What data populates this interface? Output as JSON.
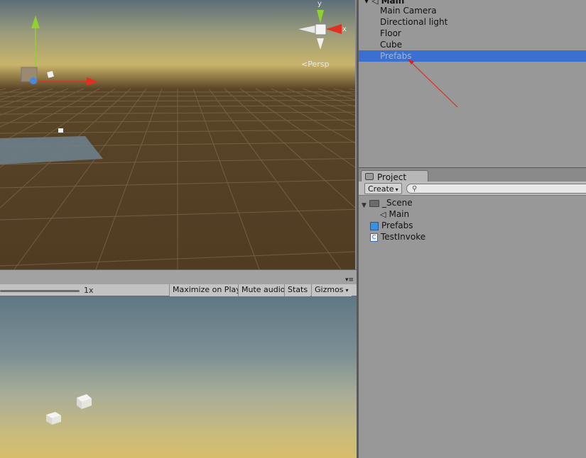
{
  "scene": {
    "persp_label": "Persp",
    "gizmo_labels": {
      "y": "y",
      "x": "x"
    }
  },
  "game_toolbar": {
    "scale_value": "1x",
    "maximize_on_play": "Maximize on Play",
    "mute_audio": "Mute audio",
    "stats": "Stats",
    "gizmos": "Gizmos"
  },
  "hierarchy": {
    "root": "Main",
    "items": [
      {
        "label": "Main Camera"
      },
      {
        "label": "Directional light"
      },
      {
        "label": "Floor"
      },
      {
        "label": "Cube"
      },
      {
        "label": "Prefabs",
        "selected": true
      }
    ]
  },
  "project": {
    "tab_label": "Project",
    "create_label": "Create",
    "search_placeholder": "",
    "items": [
      {
        "label": "_Scene",
        "icon": "folder-icon",
        "expanded": true
      },
      {
        "label": "Main",
        "icon": "unity-scene-icon"
      },
      {
        "label": "Prefabs",
        "icon": "prefab-cube-icon"
      },
      {
        "label": "TestInvoke",
        "icon": "csharp-script-icon"
      }
    ]
  },
  "colors": {
    "selection": "#3b6fd0",
    "annotation_arrow": "#e0201a",
    "gizmo_x": "#e0301f",
    "gizmo_y": "#8fd12f",
    "gizmo_z": "#4a87e0"
  }
}
